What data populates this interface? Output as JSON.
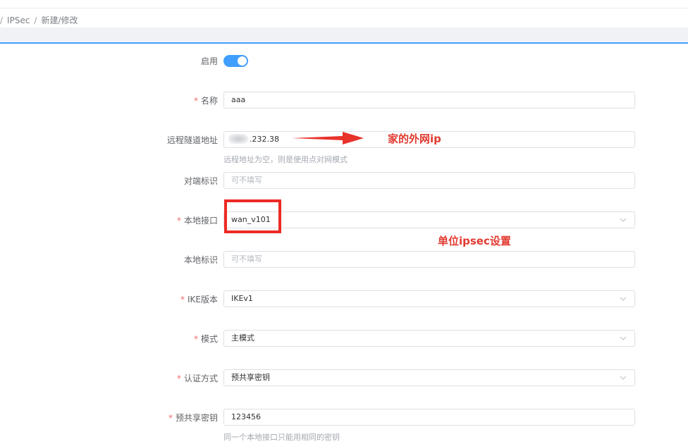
{
  "breadcrumb": {
    "separator": "/",
    "items": [
      "IPSec",
      "新建/修改"
    ]
  },
  "form": {
    "enable": {
      "label": "启用",
      "on": true
    },
    "name": {
      "label": "名称",
      "required": true,
      "value": "aaa"
    },
    "remote_addr": {
      "label": "远程隧道地址",
      "required": false,
      "value": ".232.38",
      "hint": "远程地址为空，则是使用点对网模式"
    },
    "peer_id": {
      "label": "对端标识",
      "required": false,
      "placeholder": "可不填写"
    },
    "local_iface": {
      "label": "本地接口",
      "required": true,
      "value": "wan_v101"
    },
    "local_id": {
      "label": "本地标识",
      "required": false,
      "placeholder": "可不填写"
    },
    "ike_version": {
      "label": "IKE版本",
      "required": true,
      "value": "IKEv1"
    },
    "mode": {
      "label": "模式",
      "required": true,
      "value": "主模式"
    },
    "auth_method": {
      "label": "认证方式",
      "required": true,
      "value": "预共享密钥"
    },
    "psk": {
      "label": "预共享密钥",
      "required": true,
      "value": "123456",
      "hint": "同一个本地接口只能用相同的密钥"
    }
  },
  "annotations": {
    "home_ip": "家的外网ip",
    "office_ipsec": "单位ipsec设置"
  },
  "colors": {
    "accent": "#409eff",
    "required": "#f56c6c",
    "annotation": "#e23a30"
  },
  "icons": {
    "select": "chevron-down-icon"
  }
}
